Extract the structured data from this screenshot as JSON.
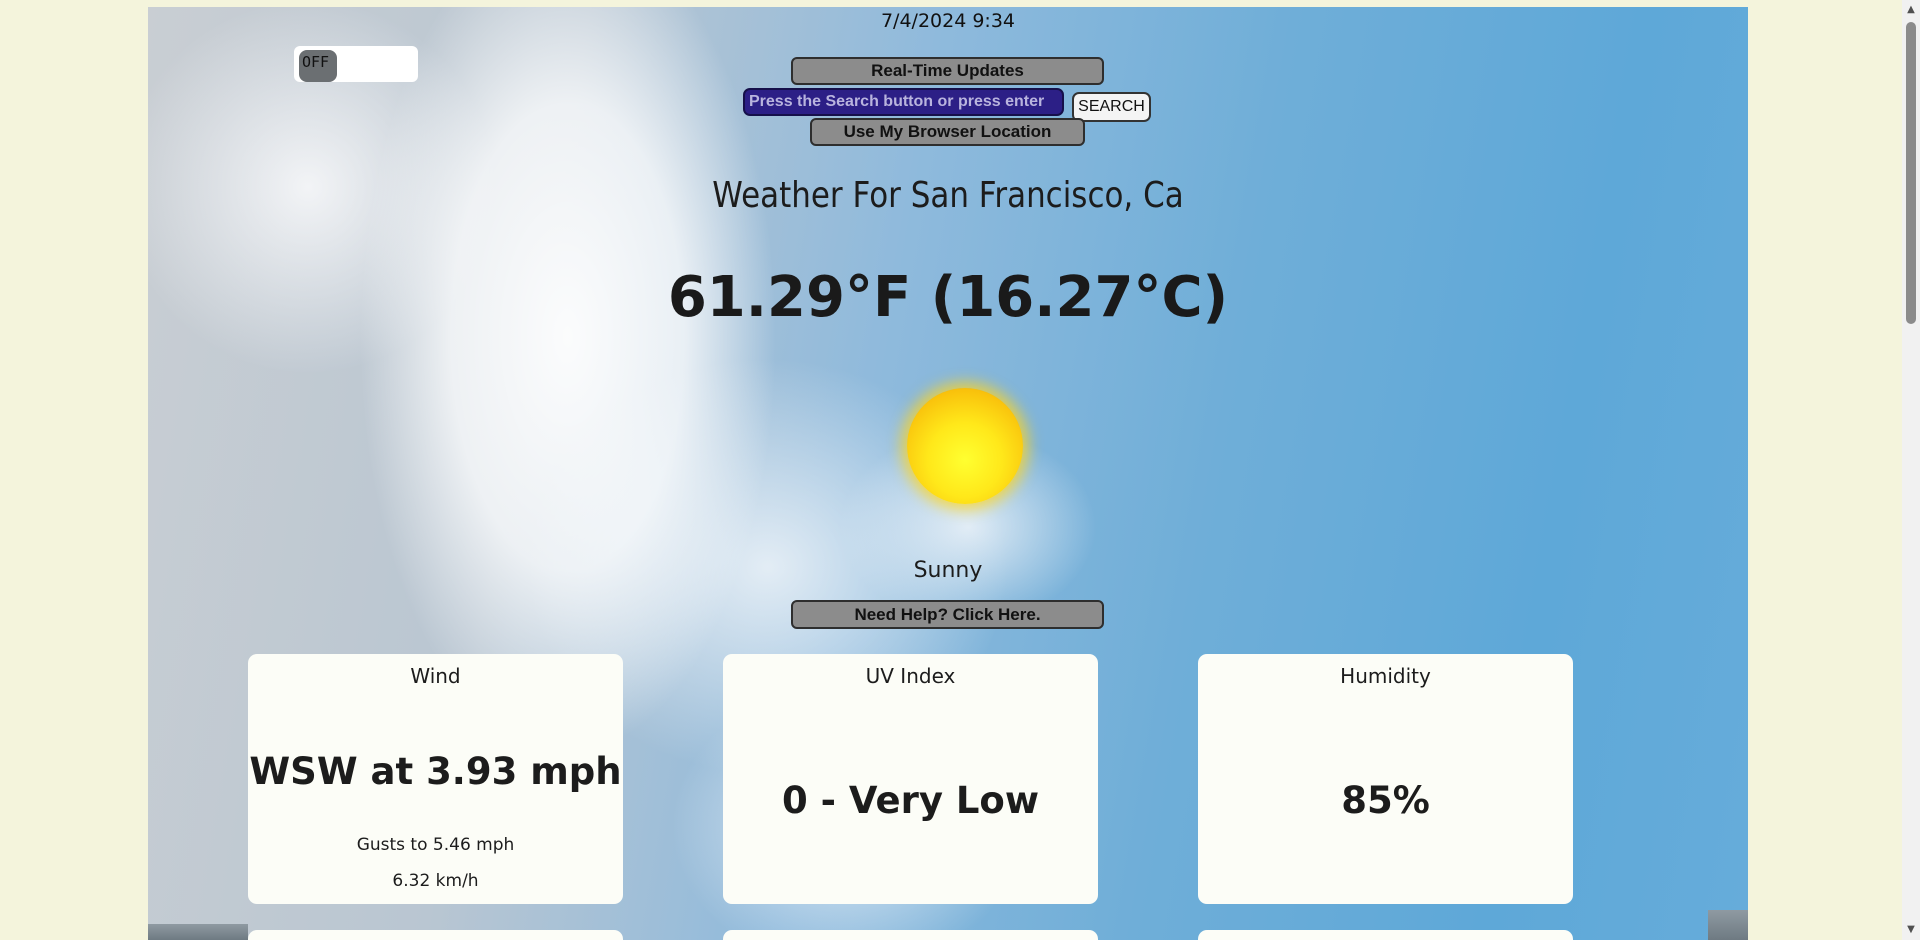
{
  "header": {
    "timestamp": "7/4/2024 9:34"
  },
  "toggle": {
    "state_label": "OFF"
  },
  "controls": {
    "realtime_label": "Real-Time Updates",
    "search_placeholder": "Press the Search button or press enter",
    "search_button_label": "SEARCH",
    "location_button_label": "Use My Browser Location",
    "help_button_label": "Need Help? Click Here."
  },
  "weather": {
    "city_heading": "Weather For San Francisco, Ca",
    "temperature": "61.29°F (16.27°C)",
    "icon": "sun-icon",
    "condition": "Sunny"
  },
  "cards": [
    {
      "title": "Wind",
      "value": "WSW at 3.93 mph",
      "sub1": "Gusts to 5.46 mph",
      "sub2": "6.32 km/h"
    },
    {
      "title": "UV Index",
      "value": "0 - Very Low"
    },
    {
      "title": "Humidity",
      "value": "85%"
    }
  ],
  "colors": {
    "page_bg": "#f4f4dc",
    "search_bg": "#2c1f86",
    "button_gray": "#8c8c8c",
    "card_bg": "#fcfdf7"
  }
}
